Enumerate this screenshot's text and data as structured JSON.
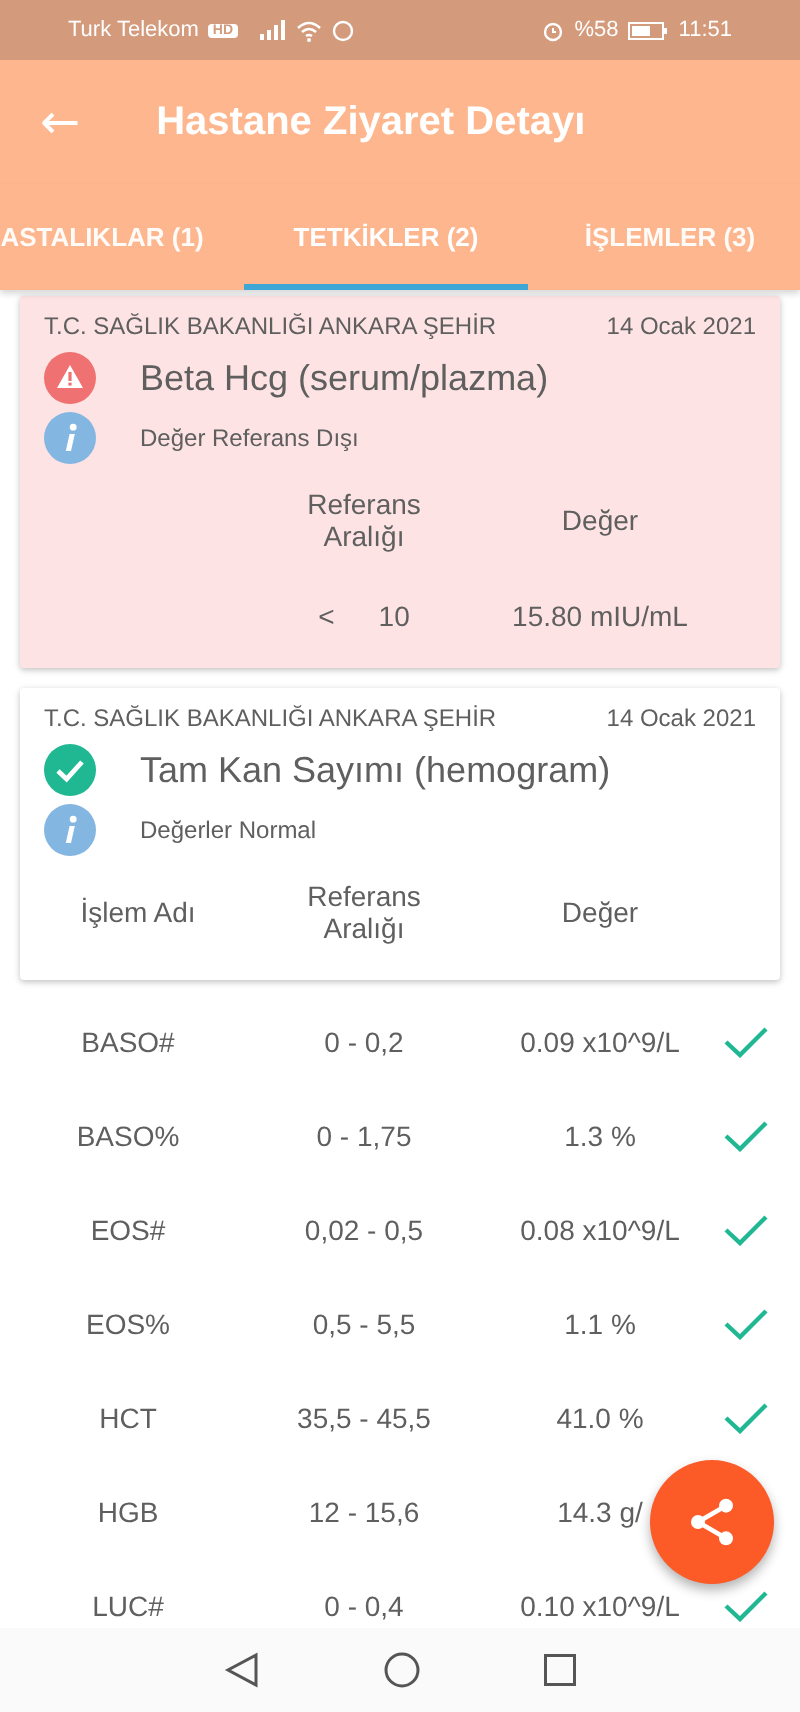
{
  "status_bar": {
    "carrier": "Turk Telekom",
    "network_badge": "HD",
    "battery": "%58",
    "time": "11:51"
  },
  "app_bar": {
    "back": "←",
    "title": "Hastane Ziyaret Detayı"
  },
  "tabs": [
    {
      "label": "ASTALIKLAR (1)",
      "selected": false
    },
    {
      "label": "TETKİKLER (2)",
      "selected": true
    },
    {
      "label": "İŞLEMLER (3)",
      "selected": false
    }
  ],
  "tests": [
    {
      "institution": "T.C. SAĞLIK BAKANLIĞI ANKARA ŞEHİR",
      "date": "14 Ocak 2021",
      "kind": "warning",
      "title": "Beta Hcg (serum/plazma)",
      "note": "Değer Referans Dışı",
      "columns": [
        "",
        "Referans Aralığı",
        "Değer"
      ],
      "result": {
        "operator": "<",
        "reference": "10",
        "value": "15.80 mIU/mL"
      }
    },
    {
      "institution": "T.C. SAĞLIK BAKANLIĞI ANKARA ŞEHİR",
      "date": "14 Ocak 2021",
      "kind": "ok",
      "title": "Tam Kan Sayımı (hemogram)",
      "note": "Değerler Normal",
      "columns": [
        "İşlem Adı",
        "Referans Aralığı",
        "Değer"
      ]
    }
  ],
  "rows": [
    {
      "name": "BASO#",
      "reference": "0 - 0,2",
      "value": "0.09 x10^9/L",
      "normal": true
    },
    {
      "name": "BASO%",
      "reference": "0 - 1,75",
      "value": "1.3 %",
      "normal": true
    },
    {
      "name": "EOS#",
      "reference": "0,02 - 0,5",
      "value": "0.08 x10^9/L",
      "normal": true
    },
    {
      "name": "EOS%",
      "reference": "0,5 - 5,5",
      "value": "1.1 %",
      "normal": true
    },
    {
      "name": "HCT",
      "reference": "35,5 - 45,5",
      "value": "41.0 %",
      "normal": true
    },
    {
      "name": "HGB",
      "reference": "12 - 15,6",
      "value": "14.3 g/"
    },
    {
      "name": "LUC#",
      "reference": "0 - 0,4",
      "value": "0.10 x10^9/L",
      "normal": true
    }
  ]
}
